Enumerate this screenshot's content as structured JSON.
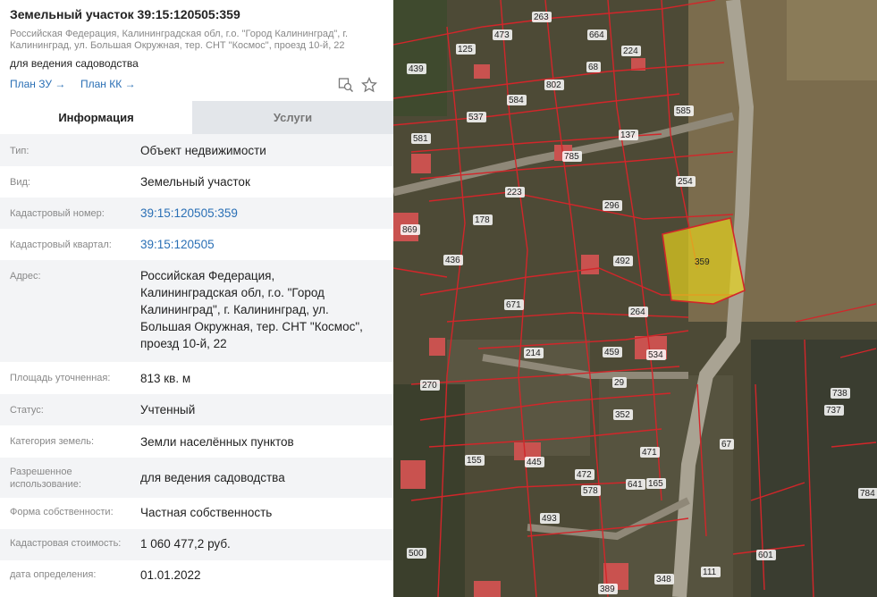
{
  "header": {
    "title": "Земельный участок 39:15:120505:359",
    "address_lines": [
      "Российская Федерация, Калининградская обл, г.о. \"Город Калининград\", г.",
      "Калининград, ул. Большая Окружная, тер. СНТ \"Космос\", проезд 10-й, 22"
    ],
    "purpose": "для ведения садоводства",
    "links": [
      "План ЗУ →",
      "План КК →"
    ]
  },
  "tabs": [
    "Информация",
    "Услуги"
  ],
  "info_rows": [
    {
      "label": "Тип:",
      "value": "Объект недвижимости"
    },
    {
      "label": "Вид:",
      "value": "Земельный участок"
    },
    {
      "label": "Кадастровый номер:",
      "value": "39:15:120505:359"
    },
    {
      "label": "Кадастровый квартал:",
      "value": "39:15:120505"
    },
    {
      "label": "Адрес:",
      "value_lines": [
        "Российская Федерация,",
        "Калининградская обл, г.о. \"Город",
        "Калининград\", г. Калининград, ул.",
        "Большая Окружная, тер. СНТ \"Космос\",",
        "проезд 10-й, 22"
      ]
    },
    {
      "label": "Площадь уточненная:",
      "value": "813 кв. м"
    },
    {
      "label": "Статус:",
      "value": "Учтенный"
    },
    {
      "label": "Категория земель:",
      "value": "Земли населённых пунктов"
    },
    {
      "label_lines": [
        "Разрешенное",
        "использование:"
      ],
      "value": "для ведения садоводства"
    },
    {
      "label": "Форма собственности:",
      "value": "Частная собственность"
    },
    {
      "label": "Кадастровая стоимость:",
      "value": "1 060 477,2 руб."
    },
    {
      "label": "дата определения:",
      "value": "01.01.2022"
    }
  ],
  "map": {
    "selected_parcel_label": "359",
    "parcel_labels": [
      "263",
      "664",
      "473",
      "439",
      "125",
      "224",
      "68",
      "802",
      "584",
      "537",
      "585",
      "581",
      "137",
      "785",
      "254",
      "223",
      "296",
      "178",
      "869",
      "436",
      "492",
      "671",
      "264",
      "214",
      "459",
      "534",
      "270",
      "29",
      "352",
      "738",
      "737",
      "155",
      "445",
      "471",
      "67",
      "472",
      "578",
      "641",
      "165",
      "784",
      "493",
      "601",
      "111",
      "348",
      "389",
      "500"
    ],
    "colors": {
      "parcel_border": "#d2262a",
      "selected_fill": "#e6d21e",
      "link": "#2a6fb5"
    }
  }
}
